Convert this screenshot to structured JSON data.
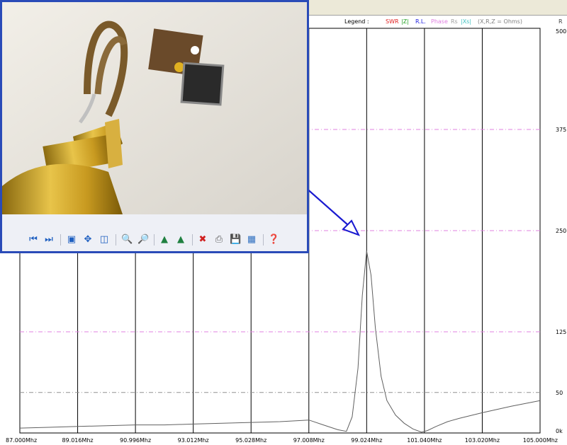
{
  "legend": {
    "label": "Legend :",
    "items": [
      {
        "text": "SWR",
        "color": "#e02020"
      },
      {
        "text": "|Z|",
        "color": "#20a020"
      },
      {
        "text": "R.L.",
        "color": "#2020e0"
      },
      {
        "text": "Phase",
        "color": "#e080e0"
      },
      {
        "text": "Rs",
        "color": "#a0a0a0"
      },
      {
        "text": "|Xs|",
        "color": "#40c0c0"
      },
      {
        "text": "(X,R,Z = Ohms)",
        "color": "#808080"
      }
    ],
    "axis_unit": "R"
  },
  "toolbar": {
    "icons": [
      "first-icon",
      "last-icon",
      "fit-icon",
      "move-icon",
      "clear-icon",
      "zoom-in-icon",
      "zoom-out-icon",
      "mark-left-icon",
      "mark-right-icon",
      "delete-icon",
      "print-icon",
      "save-icon",
      "export-icon",
      "help-icon"
    ]
  },
  "chart_data": {
    "type": "line",
    "xlabel": "",
    "ylabel": "R",
    "x_ticks": [
      "87.000Mhz",
      "89.016Mhz",
      "90.996Mhz",
      "93.012Mhz",
      "95.028Mhz",
      "97.008Mhz",
      "99.024Mhz",
      "101.040Mhz",
      "103.020Mhz",
      "105.000Mhz"
    ],
    "y_ticks": [
      "0k",
      "50",
      "125",
      "250",
      "375",
      "500"
    ],
    "ylim": [
      0,
      500
    ],
    "xlim": [
      87.0,
      105.0
    ],
    "series": [
      {
        "values_x": [
          87.0,
          88.0,
          89.0,
          90.0,
          91.0,
          92.0,
          93.0,
          94.0,
          95.0,
          96.0,
          97.0,
          97.5,
          98.0,
          98.3,
          98.5,
          98.7,
          98.85,
          99.0,
          99.15,
          99.3,
          99.5,
          99.7,
          100.0,
          100.3,
          100.6,
          100.9,
          101.1,
          101.4,
          101.8,
          102.2,
          103.0,
          104.0,
          105.0
        ],
        "values_y": [
          6,
          7,
          8,
          9,
          10,
          10,
          11,
          12,
          13,
          14,
          16,
          10,
          4,
          2,
          20,
          80,
          170,
          225,
          195,
          130,
          70,
          40,
          22,
          12,
          5,
          1,
          3,
          8,
          14,
          18,
          25,
          33,
          40
        ]
      }
    ]
  }
}
